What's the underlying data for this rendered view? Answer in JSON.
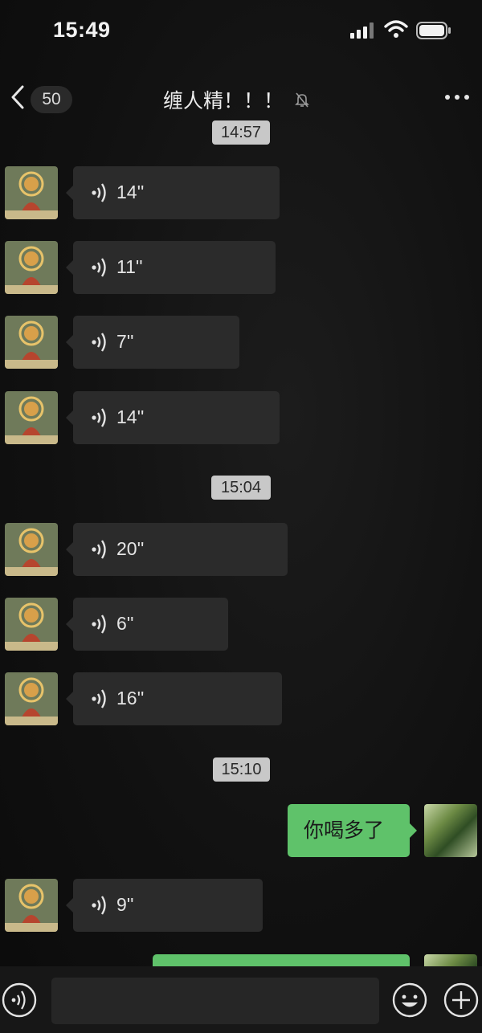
{
  "status_bar": {
    "time": "15:49",
    "icons": [
      "signal-icon",
      "wifi-icon",
      "battery-icon"
    ]
  },
  "header": {
    "unread_count": "50",
    "title": "缠人精！！！",
    "icons": [
      "back-icon",
      "mute-icon",
      "more-icon"
    ]
  },
  "messages": [
    {
      "type": "timestamp",
      "text": "14:57"
    },
    {
      "type": "voice",
      "side": "received",
      "duration": "14''"
    },
    {
      "type": "voice",
      "side": "received",
      "duration": "11''"
    },
    {
      "type": "voice",
      "side": "received",
      "duration": "7''"
    },
    {
      "type": "voice",
      "side": "received",
      "duration": "14''"
    },
    {
      "type": "timestamp",
      "text": "15:04"
    },
    {
      "type": "voice",
      "side": "received",
      "duration": "20''"
    },
    {
      "type": "voice",
      "side": "received",
      "duration": "6''"
    },
    {
      "type": "voice",
      "side": "received",
      "duration": "16''"
    },
    {
      "type": "timestamp",
      "text": "15:10"
    },
    {
      "type": "text",
      "side": "sent",
      "text": "你喝多了"
    },
    {
      "type": "voice",
      "side": "received",
      "duration": "9''"
    },
    {
      "type": "text",
      "side": "sent",
      "text": ""
    }
  ],
  "input_bar": {
    "placeholder": "",
    "icons": [
      "voice-toggle-icon",
      "emoji-icon",
      "plus-icon"
    ]
  },
  "colors": {
    "background": "#111111",
    "received_bubble": "#2b2b2b",
    "sent_bubble": "#5fc26a",
    "timestamp_chip": "#c8c8c8"
  }
}
